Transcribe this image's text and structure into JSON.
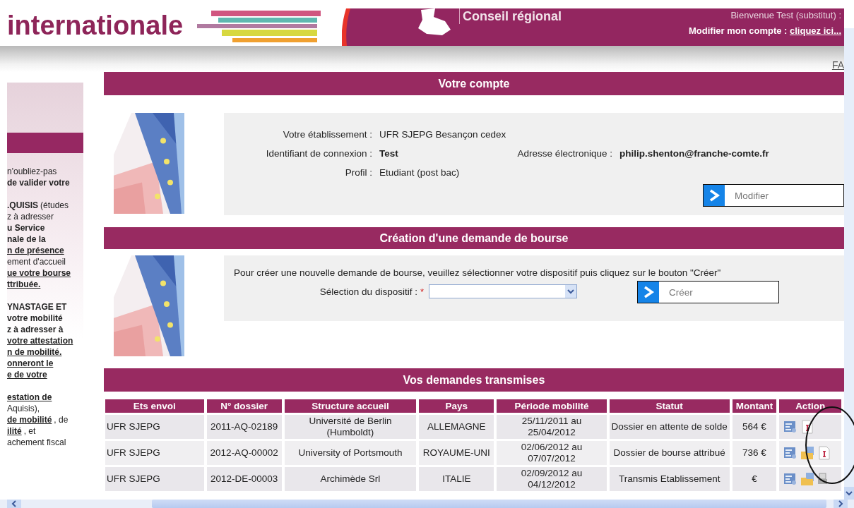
{
  "header": {
    "site_title": "internationale",
    "region_label": "Conseil régional",
    "welcome": "Bienvenue Test (substitut) :",
    "account_label": "Modifier mon compte :",
    "account_link": "cliquez ici..."
  },
  "faq_link": "FA",
  "sidebar": {
    "paragraphs": [
      [
        [
          {
            "text": "n'oubliez-pas",
            "kind": "plain"
          }
        ],
        [
          {
            "text": "de valider votre",
            "kind": "bold"
          }
        ]
      ],
      [
        [
          {
            "text": ".QUISIS",
            "kind": "bold"
          },
          {
            "text": "(études",
            "kind": "plain"
          }
        ],
        [
          {
            "text": "z à adresser",
            "kind": "plain"
          }
        ],
        [
          {
            "text": "u Service",
            "kind": "bold"
          }
        ],
        [
          {
            "text": "nale de la",
            "kind": "bold"
          }
        ],
        [
          {
            "text": "n de présence",
            "kind": "link"
          }
        ],
        [
          {
            "text": "ement d'accueil",
            "kind": "plain"
          }
        ],
        [
          {
            "text": "ue votre bourse",
            "kind": "link"
          }
        ],
        [
          {
            "text": "ttribuée.",
            "kind": "link"
          }
        ]
      ],
      [
        [
          {
            "text": "YNASTAGE ET",
            "kind": "bold"
          }
        ],
        [
          {
            "text": "votre mobilité",
            "kind": "bold"
          }
        ],
        [
          {
            "text": "z à adresser à",
            "kind": "bold"
          }
        ],
        [
          {
            "text": "votre attestation",
            "kind": "link"
          }
        ],
        [
          {
            "text": "n de mobilité.",
            "kind": "link"
          }
        ],
        [
          {
            "text": "onneront le",
            "kind": "link"
          }
        ],
        [
          {
            "text": "e de votre",
            "kind": "link"
          }
        ]
      ],
      [
        [
          {
            "text": "estation de",
            "kind": "link"
          }
        ],
        [
          {
            "text": "Aquisis),",
            "kind": "plain"
          }
        ],
        [
          {
            "text": "de mobilité",
            "kind": "link"
          },
          {
            "text": ", de",
            "kind": "plain"
          }
        ],
        [
          {
            "text": "ilité",
            "kind": "link"
          },
          {
            "text": ", et",
            "kind": "plain"
          }
        ],
        [
          {
            "text": "achement fiscal",
            "kind": "plain"
          }
        ]
      ]
    ]
  },
  "account": {
    "title": "Votre compte",
    "rows": [
      [
        {
          "label": "Votre établissement :",
          "value": "UFR SJEPG Besançon cedex"
        }
      ],
      [
        {
          "label": "Identifiant de connexion :",
          "value": "**Test**"
        },
        {
          "label": "Adresse électronique :",
          "value": "**philip.shenton@franche-comte.fr**"
        }
      ],
      [
        {
          "label": "Profil :",
          "value": "Etudiant (post bac)"
        }
      ]
    ],
    "button": "Modifier"
  },
  "creation": {
    "title": "Création d'une demande de bourse",
    "intro": "Pour créer une nouvelle demande de bourse, veuillez sélectionner votre dispositif puis cliquez sur le bouton \"Créer\"",
    "select_label": "Sélection du dispositif :",
    "required_mark": "*",
    "button": "Créer"
  },
  "requests": {
    "title": "Vos demandes transmises",
    "columns": [
      "Ets envoi",
      "N° dossier",
      "Structure accueil",
      "Pays",
      "Période mobilité",
      "Statut",
      "Montant",
      "Action"
    ],
    "rows": [
      {
        "cells": [
          "UFR SJEPG",
          "2011-AQ-02189",
          "Université de Berlin (Humboldt)",
          "ALLEMAGNE",
          "25/11/2011 au 25/04/2012",
          "Dossier en attente de solde",
          "564 €"
        ],
        "actions": [
          {
            "kind": "details"
          },
          {
            "kind": "pdf"
          }
        ]
      },
      {
        "cells": [
          "UFR SJEPG",
          "2012-AQ-00002",
          "University of Portsmouth",
          "ROYAUME-UNI",
          "02/06/2012 au 07/07/2012",
          "Dossier de bourse attribué",
          "736 €"
        ],
        "actions": [
          {
            "kind": "details"
          },
          {
            "kind": "folder"
          },
          {
            "kind": "pdf"
          }
        ]
      },
      {
        "cells": [
          "UFR SJEPG",
          "2012-DE-00003",
          "Archimède Srl",
          "ITALIE",
          "02/09/2012 au 04/12/2012",
          "Transmis Etablissement",
          "€"
        ],
        "actions": [
          {
            "kind": "details"
          },
          {
            "kind": "folder"
          },
          {
            "kind": "print"
          }
        ]
      }
    ]
  }
}
